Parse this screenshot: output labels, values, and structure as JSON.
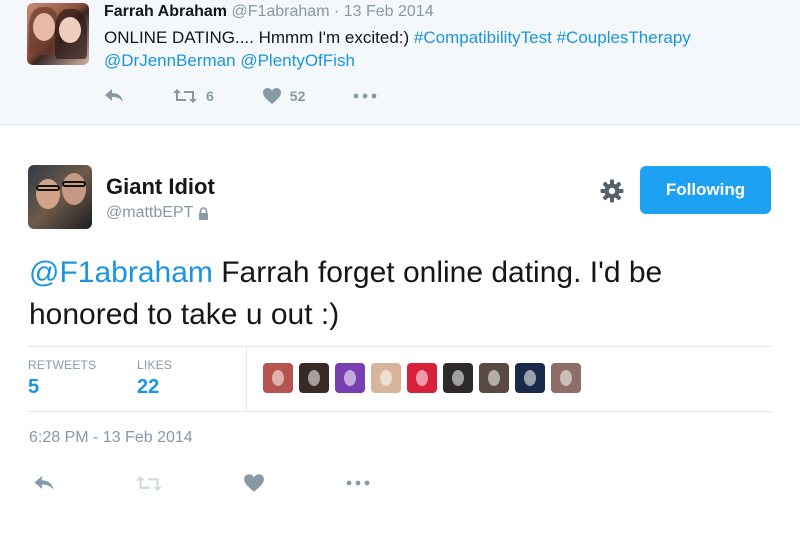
{
  "parent_tweet": {
    "name": "Farrah Abraham",
    "handle": "@F1abraham",
    "separator": "·",
    "date": "13 Feb 2014",
    "text_plain": "ONLINE DATING.... Hmmm I'm excited:) ",
    "hashtag1": "#CompatibilityTest",
    "hashtag2": "#CouplesTherapy",
    "mention1": "@DrJennBerman",
    "mention2": "@PlentyOfFish",
    "retweet_count": "6",
    "like_count": "52"
  },
  "main_tweet": {
    "name": "Giant Idiot",
    "handle": "@mattbEPT",
    "follow_label": "Following",
    "mention": "@F1abraham",
    "text": " Farrah forget online dating.  I'd be honored to take u out :)",
    "stats": {
      "retweets_label": "RETWEETS",
      "retweets_value": "5",
      "likes_label": "LIKES",
      "likes_value": "22"
    },
    "timestamp": "6:28 PM - 13 Feb 2014",
    "liker_colors": [
      "#b5534e",
      "#3a2a26",
      "#7a3fb0",
      "#d8b59a",
      "#d8203a",
      "#2f2a2a",
      "#5a4a44",
      "#1c2a4a",
      "#8e6e66"
    ]
  },
  "colors": {
    "link": "#1b95e0",
    "follow_button": "#1da1f2",
    "muted": "#8899a6",
    "parent_bg": "#f5f8fa"
  },
  "icons": [
    "reply-icon",
    "retweet-icon",
    "heart-icon",
    "more-icon",
    "gear-icon",
    "lock-icon"
  ]
}
